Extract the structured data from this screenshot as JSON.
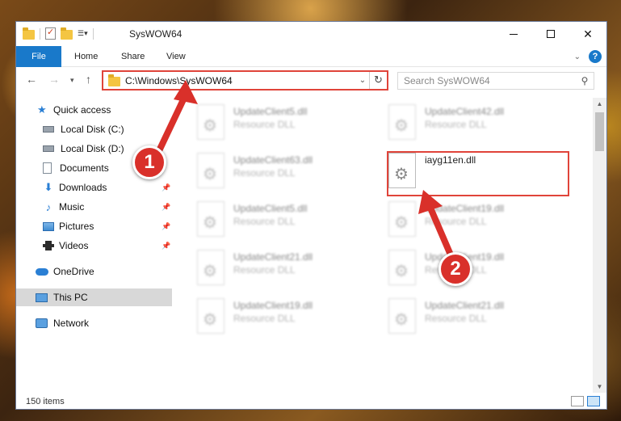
{
  "window": {
    "title": "SysWOW64",
    "minimize": "—",
    "maximize": "",
    "close": "✕"
  },
  "ribbon": {
    "tabs": [
      "File",
      "Home",
      "Share",
      "View"
    ],
    "help": "?"
  },
  "address": {
    "path": "C:\\Windows\\SysWOW64",
    "search_placeholder": "Search SysWOW64"
  },
  "sidebar": {
    "items": [
      {
        "label": "Quick access",
        "icon": "star-icon"
      },
      {
        "label": "Local Disk (C:)",
        "icon": "disk-icon"
      },
      {
        "label": "Local Disk (D:)",
        "icon": "disk-icon"
      },
      {
        "label": "Documents",
        "icon": "documents-icon"
      },
      {
        "label": "Downloads",
        "icon": "download-icon"
      },
      {
        "label": "Music",
        "icon": "music-icon"
      },
      {
        "label": "Pictures",
        "icon": "pictures-icon"
      },
      {
        "label": "Videos",
        "icon": "videos-icon"
      },
      {
        "label": "OneDrive",
        "icon": "cloud-icon"
      },
      {
        "label": "This PC",
        "icon": "computer-icon"
      },
      {
        "label": "Network",
        "icon": "network-icon"
      }
    ]
  },
  "files": [
    {
      "name": "UpdateClient5.dll",
      "desc": "Resource DLL"
    },
    {
      "name": "UpdateClient42.dll",
      "desc": "Resource DLL"
    },
    {
      "name": "UpdateClient63.dll",
      "desc": "Resource DLL"
    },
    {
      "name": "iayg11en.dll",
      "desc": ""
    },
    {
      "name": "UpdateClient5.dll",
      "desc": "Resource DLL"
    },
    {
      "name": "UpdateClient19.dll",
      "desc": "Resource DLL"
    },
    {
      "name": "UpdateClient21.dll",
      "desc": "Resource DLL"
    },
    {
      "name": "UpdateClient19.dll",
      "desc": "Resource DLL"
    },
    {
      "name": "UpdateClient19.dll",
      "desc": "Resource DLL"
    },
    {
      "name": "UpdateClient21.dll",
      "desc": "Resource DLL"
    }
  ],
  "status": {
    "item_count": "150 items"
  },
  "annotations": {
    "step1": "1",
    "step2": "2"
  },
  "colors": {
    "accent": "#1979ca",
    "highlight": "#e0443a"
  }
}
